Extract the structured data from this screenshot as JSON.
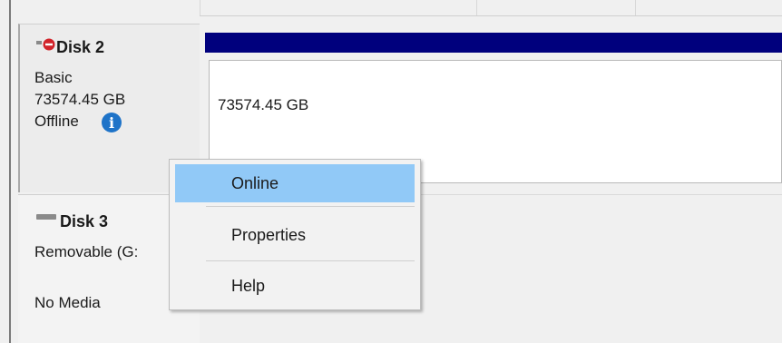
{
  "disk2": {
    "name": "Disk 2",
    "type": "Basic",
    "size": "73574.45 GB",
    "status": "Offline",
    "status_icon": "info-icon",
    "volume_size": "73574.45 GB",
    "icon": "disk-offline-icon"
  },
  "disk3": {
    "name": "Disk 3",
    "type": "Removable (G:",
    "media": "No Media",
    "icon": "removable-disk-icon"
  },
  "context_menu": {
    "items": [
      {
        "label": "Online",
        "highlighted": true
      },
      {
        "label": "Properties",
        "highlighted": false
      },
      {
        "label": "Help",
        "highlighted": false
      }
    ]
  },
  "colors": {
    "volume_header": "#00007d",
    "menu_highlight": "#91c9f7",
    "info_icon": "#1e73c8",
    "offline_badge": "#d2232a"
  },
  "info_glyph": "i"
}
